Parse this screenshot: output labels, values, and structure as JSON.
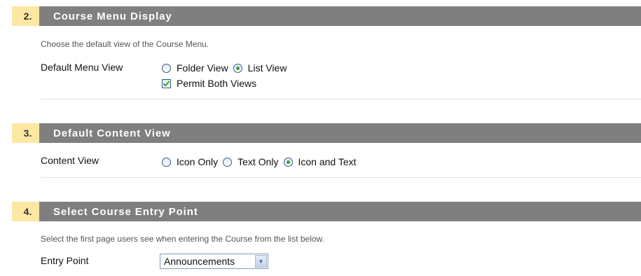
{
  "sections": [
    {
      "number": "2.",
      "title": "Course Menu Display",
      "instructions": "Choose the default view of the Course Menu.",
      "field_label": "Default Menu View",
      "options": [
        {
          "label": "Folder View",
          "type": "radio",
          "checked": false
        },
        {
          "label": "List View",
          "type": "radio",
          "checked": true
        }
      ],
      "checkbox": {
        "label": "Permit Both Views",
        "checked": true
      }
    },
    {
      "number": "3.",
      "title": "Default Content View",
      "field_label": "Content View",
      "options": [
        {
          "label": "Icon Only",
          "type": "radio",
          "checked": false
        },
        {
          "label": "Text Only",
          "type": "radio",
          "checked": false
        },
        {
          "label": "Icon and Text",
          "type": "radio",
          "checked": true
        }
      ]
    },
    {
      "number": "4.",
      "title": "Select Course Entry Point",
      "instructions": "Select the first page users see when entering the Course from the list below.",
      "field_label": "Entry Point",
      "select_value": "Announcements"
    }
  ],
  "colors": {
    "header_bg": "#7f7f7f",
    "step_number_bg": "#fce8a3",
    "radio_selected": "#2ea232"
  }
}
